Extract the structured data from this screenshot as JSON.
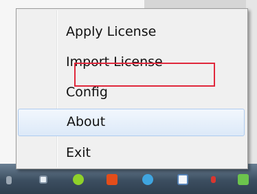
{
  "menu": {
    "items": [
      {
        "label": "Apply License"
      },
      {
        "label": "Import License"
      },
      {
        "label": "Config"
      },
      {
        "label": "About",
        "hovered": true
      },
      {
        "label": "Exit"
      }
    ]
  },
  "annotation": {
    "highlight_color": "#e0283c",
    "highlighted_item": "Import License"
  },
  "taskbar": {
    "icons": [
      "app-icon",
      "window-icon",
      "add-icon",
      "folder-icon",
      "chat-icon",
      "network-icon",
      "volume-icon",
      "shield-icon"
    ]
  }
}
